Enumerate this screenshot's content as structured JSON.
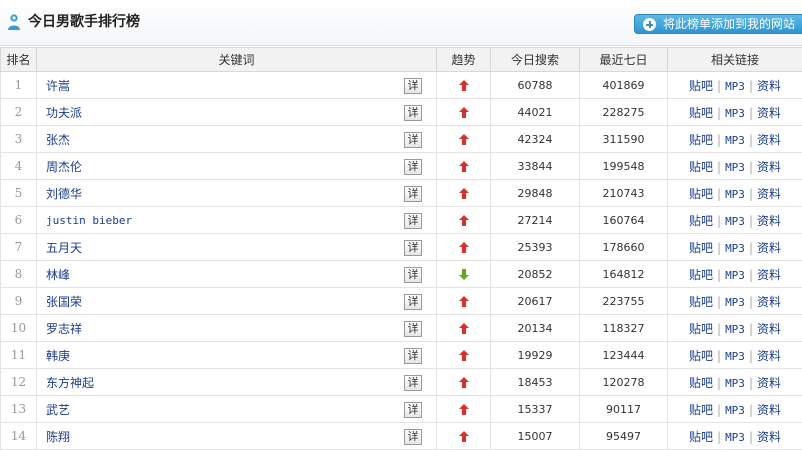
{
  "header": {
    "title": "今日男歌手排行榜",
    "add_button_label": "将此榜单添加到我的网站"
  },
  "columns": {
    "rank": "排名",
    "keyword": "关键词",
    "trend": "趋势",
    "today": "今日搜索",
    "week": "最近七日",
    "links": "相关链接"
  },
  "labels": {
    "detail": "详",
    "tieba": "贴吧",
    "mp3": "MP3",
    "profile": "资料"
  },
  "colors": {
    "up": "#d9302c",
    "down": "#5aab1e",
    "link": "#1a3d8f",
    "accent": "#2e95cf"
  },
  "rows": [
    {
      "rank": "1",
      "keyword": "许嵩",
      "trend": "up",
      "today": "60788",
      "week": "401869"
    },
    {
      "rank": "2",
      "keyword": "功夫派",
      "trend": "up",
      "today": "44021",
      "week": "228275"
    },
    {
      "rank": "3",
      "keyword": "张杰",
      "trend": "up",
      "today": "42324",
      "week": "311590"
    },
    {
      "rank": "4",
      "keyword": "周杰伦",
      "trend": "up",
      "today": "33844",
      "week": "199548"
    },
    {
      "rank": "5",
      "keyword": "刘德华",
      "trend": "up",
      "today": "29848",
      "week": "210743"
    },
    {
      "rank": "6",
      "keyword": "justin bieber",
      "trend": "up",
      "today": "27214",
      "week": "160764"
    },
    {
      "rank": "7",
      "keyword": "五月天",
      "trend": "up",
      "today": "25393",
      "week": "178660"
    },
    {
      "rank": "8",
      "keyword": "林峰",
      "trend": "down",
      "today": "20852",
      "week": "164812"
    },
    {
      "rank": "9",
      "keyword": "张国荣",
      "trend": "up",
      "today": "20617",
      "week": "223755"
    },
    {
      "rank": "10",
      "keyword": "罗志祥",
      "trend": "up",
      "today": "20134",
      "week": "118327"
    },
    {
      "rank": "11",
      "keyword": "韩庚",
      "trend": "up",
      "today": "19929",
      "week": "123444"
    },
    {
      "rank": "12",
      "keyword": "东方神起",
      "trend": "up",
      "today": "18453",
      "week": "120278"
    },
    {
      "rank": "13",
      "keyword": "武艺",
      "trend": "up",
      "today": "15337",
      "week": "90117"
    },
    {
      "rank": "14",
      "keyword": "陈翔",
      "trend": "up",
      "today": "15007",
      "week": "95497"
    }
  ]
}
